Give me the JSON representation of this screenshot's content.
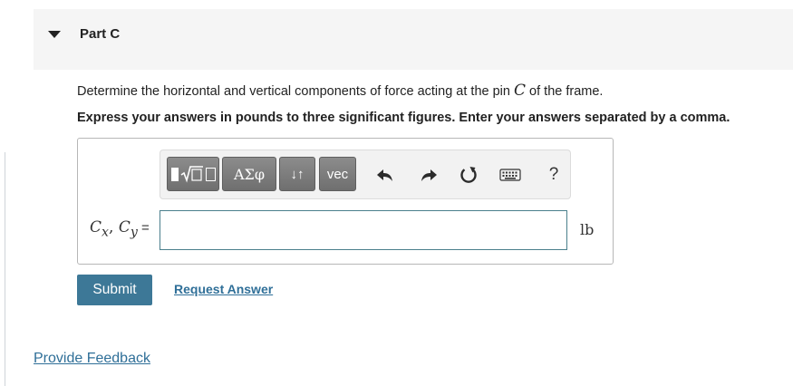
{
  "part": {
    "title": "Part C",
    "collapse_icon": "caret-down-icon"
  },
  "question": {
    "text_before": "Determine the horizontal and vertical components of force acting at the pin ",
    "variable": "C",
    "text_after": " of the frame.",
    "instruction": "Express your answers in pounds to three significant figures. Enter your answers separated by a comma."
  },
  "toolbar": {
    "template_icon": "templates-icon",
    "greek_label": "ΑΣφ",
    "arrows_label": "↓↑",
    "vec_label": "vec",
    "undo_icon": "undo-icon",
    "redo_icon": "redo-icon",
    "reset_icon": "reset-icon",
    "keyboard_icon": "keyboard-icon",
    "help_label": "?"
  },
  "answer": {
    "label_cx": "C",
    "label_cx_sub": "x",
    "label_sep": ", ",
    "label_cy": "C",
    "label_cy_sub": "y",
    "label_eq": " =",
    "value": "",
    "unit": "lb"
  },
  "actions": {
    "submit_label": "Submit",
    "request_label": "Request Answer"
  },
  "footer": {
    "feedback_label": "Provide Feedback"
  }
}
